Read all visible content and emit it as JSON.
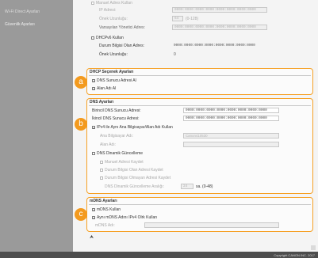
{
  "sidebar": {
    "items": [
      {
        "label": "Wi-Fi Direct Ayarları"
      },
      {
        "label": "Güvenlik Ayarları"
      }
    ]
  },
  "top": {
    "manual_address": "Manuel Adres Kullan",
    "ip_label": "IP Adresi:",
    "ip_value": "0000:0000:0000:0000:0000:0000:0000:0000",
    "prefix_label": "Önek Uzunluğu:",
    "prefix_value": "64",
    "prefix_range": "(0-128)",
    "gateway_label": "Varsayılan Yönetici Adres:",
    "gateway_value": "0000:0000:0000:0000:0000:0000:0000:0000",
    "dhcpv6_label": "DHCPv6 Kullan",
    "dhcp_addr_label": "Durum Bilgisi Olan Adres:",
    "dhcp_addr_value": "0000:0000:0000:0000:0000:0000:0000:0000",
    "dhcp_prefix_label": "Önek Uzunluğu:",
    "dhcp_prefix_value": "0"
  },
  "dhcp_section": {
    "title": "DHCP Seçenek Ayarları",
    "opt1": "DNS Sunucu Adresi Al",
    "opt2": "Alan Adı Al",
    "badge": "a"
  },
  "dns_section": {
    "title": "DNS Ayarları",
    "primary_label": "Birincil DNS Sunucu Adresi:",
    "primary_value": "0000:0000:0000:0000:0000:0000:0000:0000",
    "secondary_label": "İkincil DNS Sunucu Adresi:",
    "secondary_value": "0000:0000:0000:0000:0000:0000:0000:0000",
    "same_host_label": "IPv4 ile Aynı Ana Bilgisayar/Alan Adı Kullan",
    "host_label": "Ana Bilgisayar Adı:",
    "host_value": "Canon410530",
    "domain_label": "Alan Adı:",
    "domain_value": "",
    "dynamic_label": "DNS Dinamik Güncelleme",
    "manual_reg_label": "Manuel Adresi Kaydet",
    "stateful_reg_label": "Durum Bilgisi Olan Adresi Kaydet",
    "stateless_reg_label": "Durum Bilgisi Olmayan Adresi Kaydet",
    "interval_label": "DNS Dinamik Güncelleme Aralığı:",
    "interval_value": "24",
    "interval_unit": "sa. (0-48)",
    "badge": "b"
  },
  "mdns_section": {
    "title": "mDNS Ayarları",
    "use_label": "mDNS Kullan",
    "same_name_label": "Aynı mDNS Adını IPv4 Olrk Kullan",
    "name_label": "mDNS Adı:",
    "name_value": "",
    "badge": "c"
  },
  "footer": {
    "copyright": "Copyright CANON INC. 2017"
  }
}
